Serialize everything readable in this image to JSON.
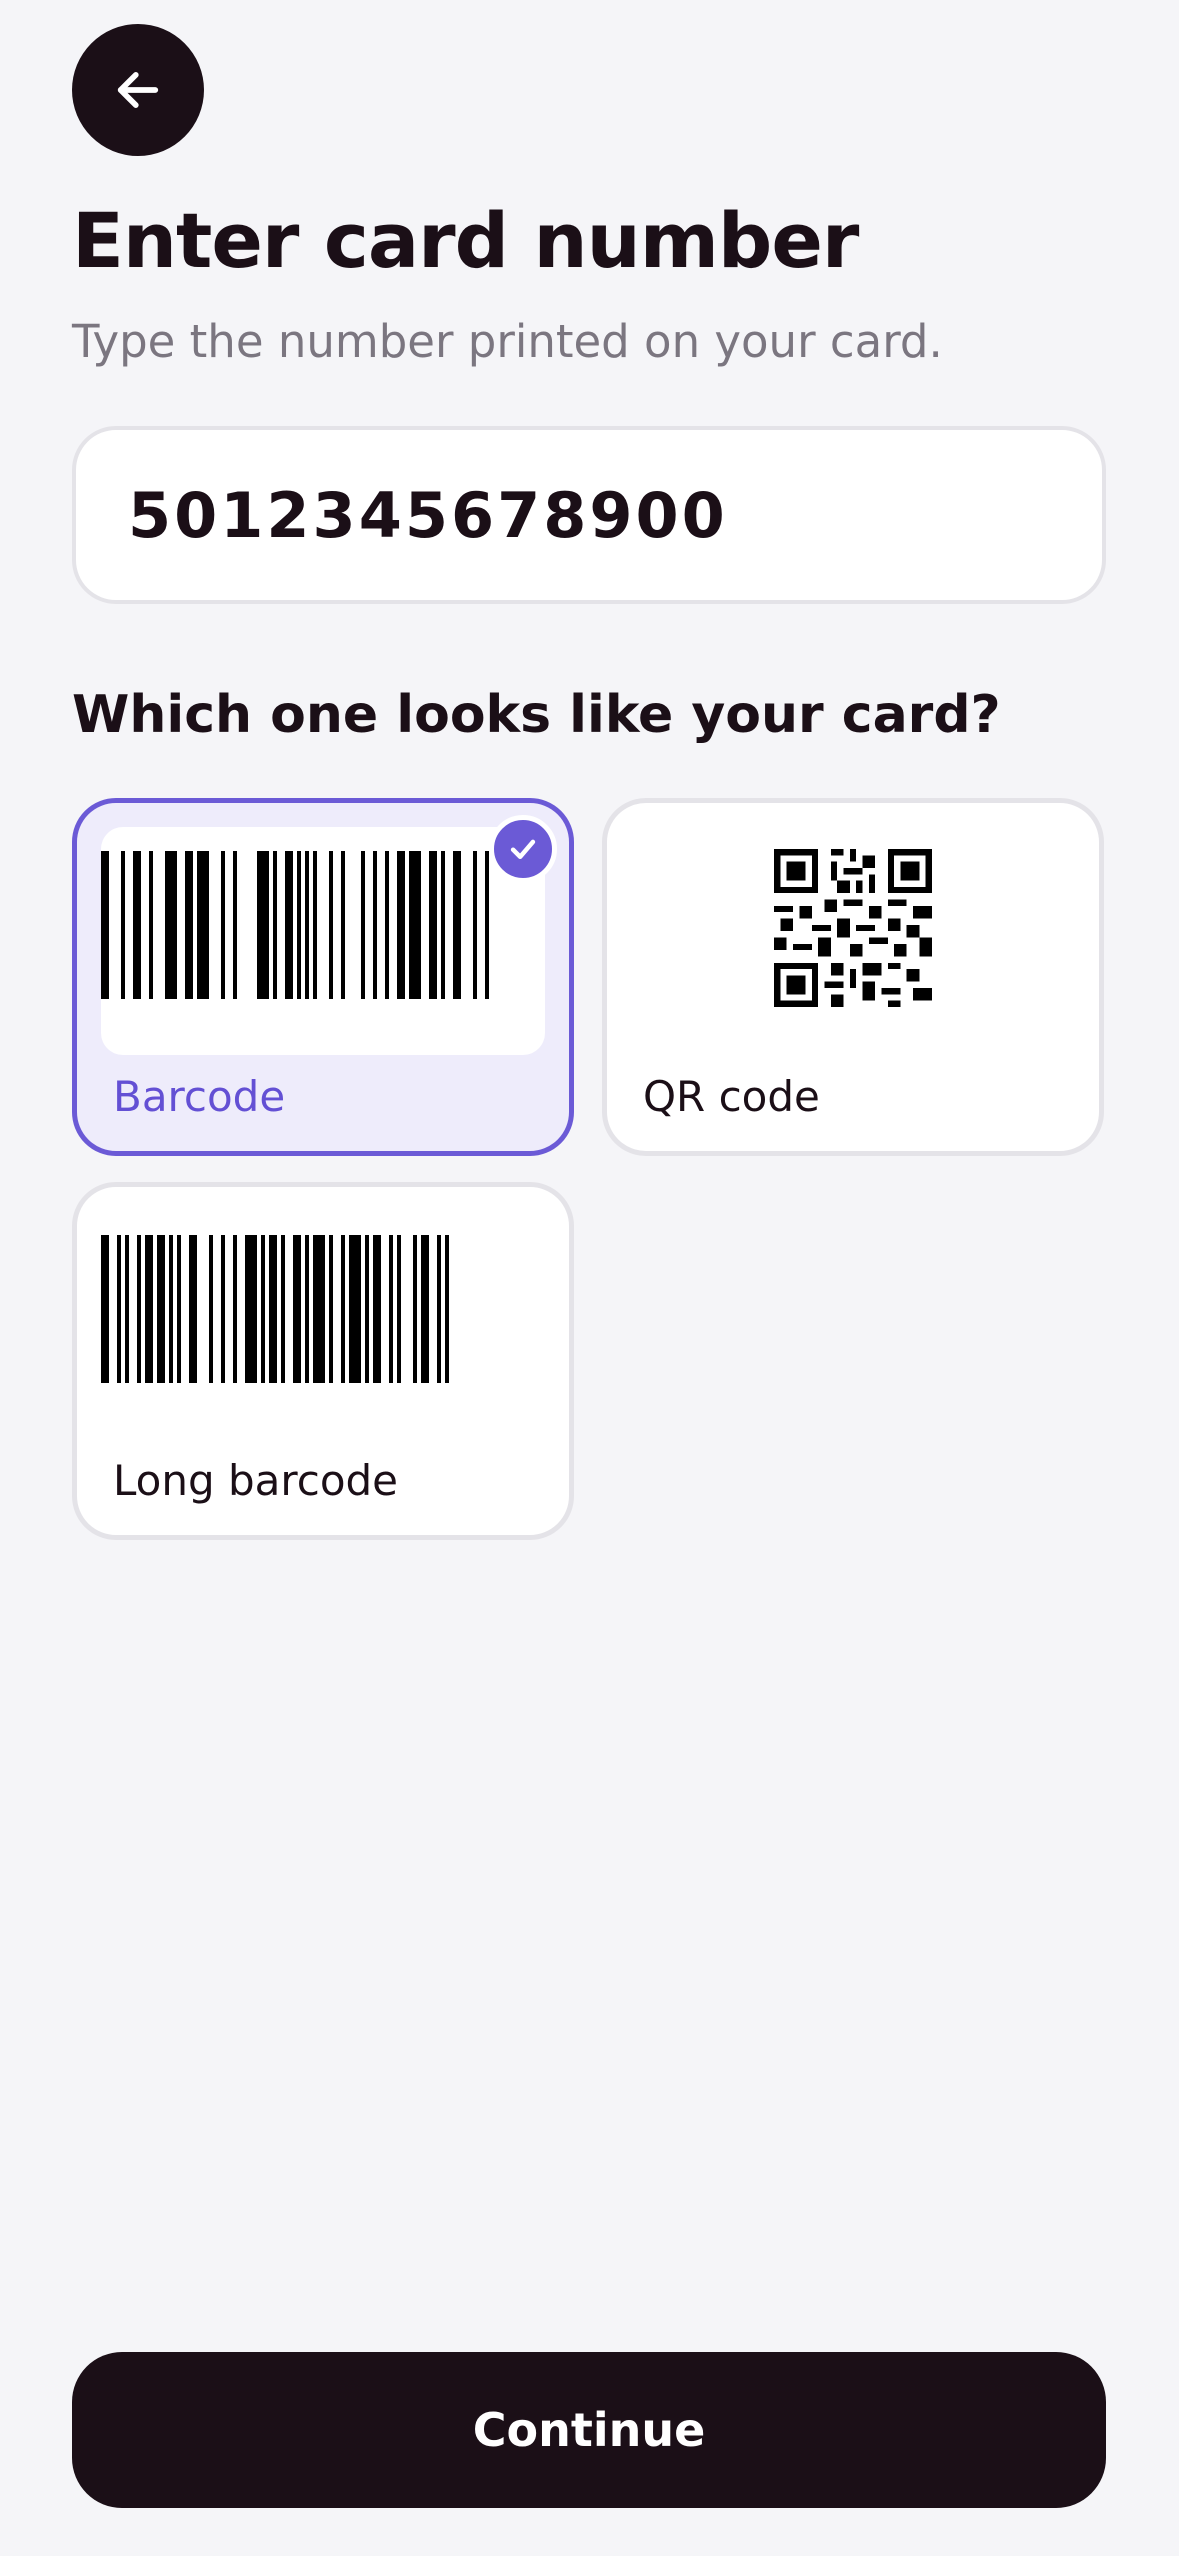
{
  "header": {
    "title": "Enter card number",
    "subtitle": "Type the number printed on your card."
  },
  "card_input": {
    "value": "5012345678900"
  },
  "question": "Which one looks like your card?",
  "options": [
    {
      "label": "Barcode",
      "selected": true
    },
    {
      "label": "QR code",
      "selected": false
    },
    {
      "label": "Long barcode",
      "selected": false
    }
  ],
  "actions": {
    "continue_label": "Continue"
  },
  "icons": {
    "back": "arrow-left-icon",
    "selected": "checkmark-icon"
  },
  "colors": {
    "background": "#f5f5f8",
    "primary_dark": "#1b0f17",
    "accent": "#6b5ad6",
    "selected_tile": "#eeecfb"
  }
}
